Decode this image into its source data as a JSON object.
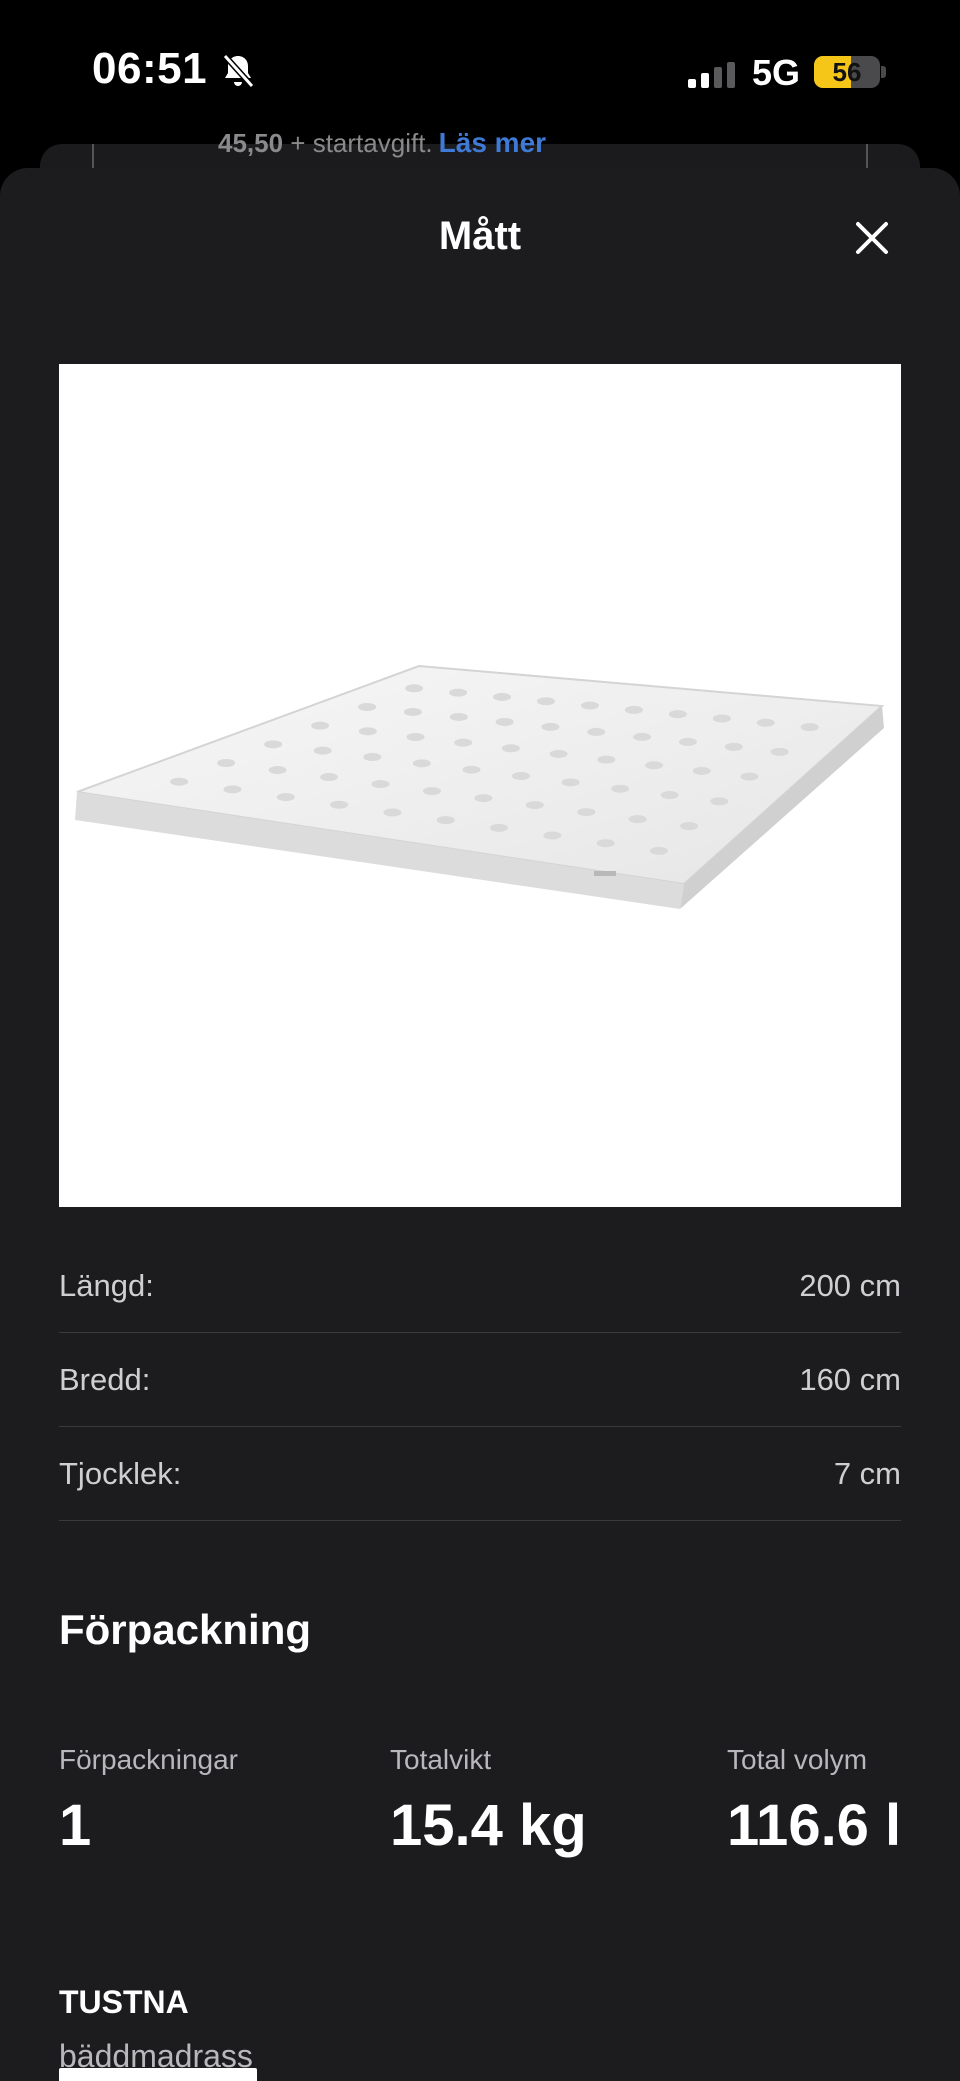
{
  "status_bar": {
    "time": "06:51",
    "network": "5G",
    "battery_level": "56",
    "battery_percent": 56,
    "battery_color": "#f5c518"
  },
  "background_card": {
    "price": "45,50",
    "text": " + startavgift.",
    "link": "Läs mer",
    "link_color": "#3f7bd6"
  },
  "sheet": {
    "title": "Mått",
    "close_icon": "close-icon"
  },
  "image": {
    "icon": "mattress-topper-image"
  },
  "dimensions": [
    {
      "label": "Längd:",
      "value": "200 cm"
    },
    {
      "label": "Bredd:",
      "value": "160 cm"
    },
    {
      "label": "Tjocklek:",
      "value": "7 cm"
    }
  ],
  "packaging": {
    "title": "Förpackning",
    "items": [
      {
        "label": "Förpackningar",
        "value": "1"
      },
      {
        "label": "Totalvikt",
        "value": "15.4 kg"
      },
      {
        "label": "Total volym",
        "value": "116.6 l"
      }
    ]
  },
  "product": {
    "name": "TUSTNA",
    "type": "bäddmadrass"
  }
}
